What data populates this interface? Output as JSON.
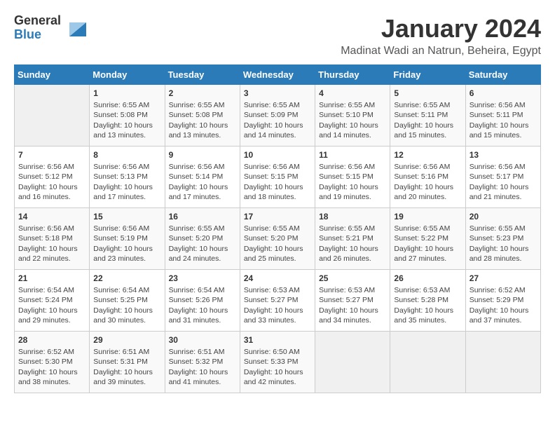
{
  "logo": {
    "general": "General",
    "blue": "Blue"
  },
  "title": "January 2024",
  "location": "Madinat Wadi an Natrun, Beheira, Egypt",
  "days_of_week": [
    "Sunday",
    "Monday",
    "Tuesday",
    "Wednesday",
    "Thursday",
    "Friday",
    "Saturday"
  ],
  "weeks": [
    [
      {
        "num": "",
        "info": ""
      },
      {
        "num": "1",
        "info": "Sunrise: 6:55 AM\nSunset: 5:08 PM\nDaylight: 10 hours\nand 13 minutes."
      },
      {
        "num": "2",
        "info": "Sunrise: 6:55 AM\nSunset: 5:08 PM\nDaylight: 10 hours\nand 13 minutes."
      },
      {
        "num": "3",
        "info": "Sunrise: 6:55 AM\nSunset: 5:09 PM\nDaylight: 10 hours\nand 14 minutes."
      },
      {
        "num": "4",
        "info": "Sunrise: 6:55 AM\nSunset: 5:10 PM\nDaylight: 10 hours\nand 14 minutes."
      },
      {
        "num": "5",
        "info": "Sunrise: 6:55 AM\nSunset: 5:11 PM\nDaylight: 10 hours\nand 15 minutes."
      },
      {
        "num": "6",
        "info": "Sunrise: 6:56 AM\nSunset: 5:11 PM\nDaylight: 10 hours\nand 15 minutes."
      }
    ],
    [
      {
        "num": "7",
        "info": "Sunrise: 6:56 AM\nSunset: 5:12 PM\nDaylight: 10 hours\nand 16 minutes."
      },
      {
        "num": "8",
        "info": "Sunrise: 6:56 AM\nSunset: 5:13 PM\nDaylight: 10 hours\nand 17 minutes."
      },
      {
        "num": "9",
        "info": "Sunrise: 6:56 AM\nSunset: 5:14 PM\nDaylight: 10 hours\nand 17 minutes."
      },
      {
        "num": "10",
        "info": "Sunrise: 6:56 AM\nSunset: 5:15 PM\nDaylight: 10 hours\nand 18 minutes."
      },
      {
        "num": "11",
        "info": "Sunrise: 6:56 AM\nSunset: 5:15 PM\nDaylight: 10 hours\nand 19 minutes."
      },
      {
        "num": "12",
        "info": "Sunrise: 6:56 AM\nSunset: 5:16 PM\nDaylight: 10 hours\nand 20 minutes."
      },
      {
        "num": "13",
        "info": "Sunrise: 6:56 AM\nSunset: 5:17 PM\nDaylight: 10 hours\nand 21 minutes."
      }
    ],
    [
      {
        "num": "14",
        "info": "Sunrise: 6:56 AM\nSunset: 5:18 PM\nDaylight: 10 hours\nand 22 minutes."
      },
      {
        "num": "15",
        "info": "Sunrise: 6:56 AM\nSunset: 5:19 PM\nDaylight: 10 hours\nand 23 minutes."
      },
      {
        "num": "16",
        "info": "Sunrise: 6:55 AM\nSunset: 5:20 PM\nDaylight: 10 hours\nand 24 minutes."
      },
      {
        "num": "17",
        "info": "Sunrise: 6:55 AM\nSunset: 5:20 PM\nDaylight: 10 hours\nand 25 minutes."
      },
      {
        "num": "18",
        "info": "Sunrise: 6:55 AM\nSunset: 5:21 PM\nDaylight: 10 hours\nand 26 minutes."
      },
      {
        "num": "19",
        "info": "Sunrise: 6:55 AM\nSunset: 5:22 PM\nDaylight: 10 hours\nand 27 minutes."
      },
      {
        "num": "20",
        "info": "Sunrise: 6:55 AM\nSunset: 5:23 PM\nDaylight: 10 hours\nand 28 minutes."
      }
    ],
    [
      {
        "num": "21",
        "info": "Sunrise: 6:54 AM\nSunset: 5:24 PM\nDaylight: 10 hours\nand 29 minutes."
      },
      {
        "num": "22",
        "info": "Sunrise: 6:54 AM\nSunset: 5:25 PM\nDaylight: 10 hours\nand 30 minutes."
      },
      {
        "num": "23",
        "info": "Sunrise: 6:54 AM\nSunset: 5:26 PM\nDaylight: 10 hours\nand 31 minutes."
      },
      {
        "num": "24",
        "info": "Sunrise: 6:53 AM\nSunset: 5:27 PM\nDaylight: 10 hours\nand 33 minutes."
      },
      {
        "num": "25",
        "info": "Sunrise: 6:53 AM\nSunset: 5:27 PM\nDaylight: 10 hours\nand 34 minutes."
      },
      {
        "num": "26",
        "info": "Sunrise: 6:53 AM\nSunset: 5:28 PM\nDaylight: 10 hours\nand 35 minutes."
      },
      {
        "num": "27",
        "info": "Sunrise: 6:52 AM\nSunset: 5:29 PM\nDaylight: 10 hours\nand 37 minutes."
      }
    ],
    [
      {
        "num": "28",
        "info": "Sunrise: 6:52 AM\nSunset: 5:30 PM\nDaylight: 10 hours\nand 38 minutes."
      },
      {
        "num": "29",
        "info": "Sunrise: 6:51 AM\nSunset: 5:31 PM\nDaylight: 10 hours\nand 39 minutes."
      },
      {
        "num": "30",
        "info": "Sunrise: 6:51 AM\nSunset: 5:32 PM\nDaylight: 10 hours\nand 41 minutes."
      },
      {
        "num": "31",
        "info": "Sunrise: 6:50 AM\nSunset: 5:33 PM\nDaylight: 10 hours\nand 42 minutes."
      },
      {
        "num": "",
        "info": ""
      },
      {
        "num": "",
        "info": ""
      },
      {
        "num": "",
        "info": ""
      }
    ]
  ]
}
